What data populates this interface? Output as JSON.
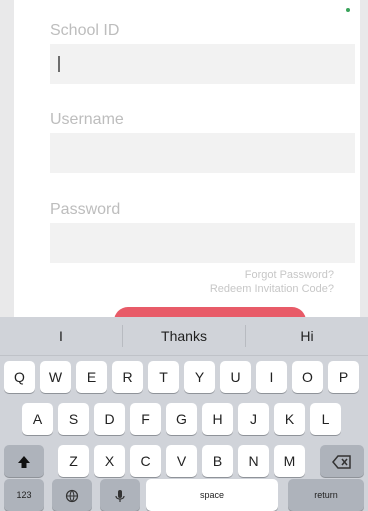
{
  "form": {
    "school_id_label": "School ID",
    "username_label": "Username",
    "password_label": "Password",
    "forgot_password": "Forgot Password?",
    "redeem_invitation": "Redeem Invitation Code?"
  },
  "keyboard": {
    "suggestions": [
      "I",
      "Thanks",
      "Hi"
    ],
    "row1": [
      "Q",
      "W",
      "E",
      "R",
      "T",
      "Y",
      "U",
      "I",
      "O",
      "P"
    ],
    "row2": [
      "A",
      "S",
      "D",
      "F",
      "G",
      "H",
      "J",
      "K",
      "L"
    ],
    "row3": [
      "Z",
      "X",
      "C",
      "V",
      "B",
      "N",
      "M"
    ],
    "numbers_key": "123",
    "space_key": "space",
    "return_key": "return",
    "shift_icon": "shift-arrow-icon",
    "delete_icon": "backspace-icon",
    "globe_icon": "globe-icon",
    "mic_icon": "microphone-icon"
  },
  "colors": {
    "accent": "#e85b68",
    "status_dot": "#3aa35b"
  }
}
